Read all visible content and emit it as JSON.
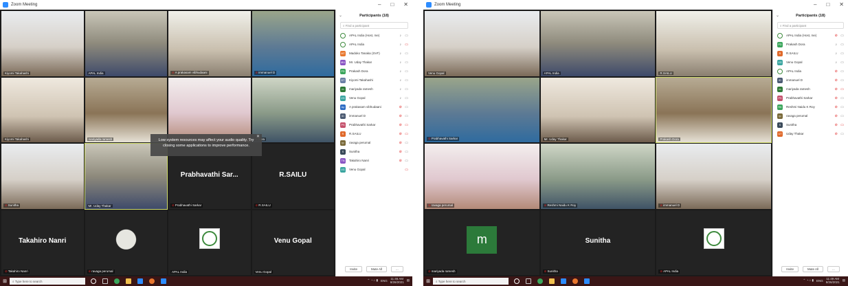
{
  "window": {
    "title": "Zoom Meeting",
    "minimize": "–",
    "maximize": "□",
    "close": "✕"
  },
  "colors": {
    "grid_bg": "#1a1a1a",
    "tile_bg": "#232323",
    "muted": "#e02828",
    "active_speaker": "#d4e06c",
    "accent": "#2d8cff"
  },
  "left": {
    "participants_title": "Participants (18)",
    "search_placeholder": "Find a participant",
    "buttons": {
      "invite": "Invite",
      "mute_all": "Mute All",
      "more": "..."
    },
    "notification": "Low system resources may affect your audio quality. Try closing some applications to improve performance.",
    "notification_close": "✕",
    "tiles": [
      {
        "name": "Kiyomi Takahashi",
        "muted": false
      },
      {
        "name": "APAL India",
        "muted": false
      },
      {
        "name": "A prakasam vibhudaani",
        "muted": true
      },
      {
        "name": "immanuel D",
        "muted": true
      },
      {
        "name": "Kiyomi Takahashi",
        "muted": false
      },
      {
        "name": "mariyada ramesh",
        "muted": false
      },
      {
        "name": "",
        "muted": false
      },
      {
        "name": "h Dora",
        "muted": false
      },
      {
        "name": "Sunitha",
        "muted": true
      },
      {
        "name": "Mr. Uday Thakar",
        "muted": false
      },
      {
        "name": "Prabhavathi Sarkar",
        "muted": true,
        "big": "Prabhavathi Sar..."
      },
      {
        "name": "R.SAILU",
        "muted": true,
        "big": "R.SAILU"
      },
      {
        "name": "Takahiro Nanri",
        "muted": true,
        "big": "Takahiro Nanri"
      },
      {
        "name": "ravaga perumal",
        "muted": true
      },
      {
        "name": "APAL India",
        "muted": false
      },
      {
        "name": "Venu Gopal",
        "muted": false,
        "big": "Venu Gopal"
      }
    ],
    "participants": [
      {
        "name": "APAL India (Host, me)",
        "color": "#ffffff",
        "initials": "",
        "mic": "on",
        "cam": "on"
      },
      {
        "name": "APAL India",
        "color": "#ffffff",
        "initials": "",
        "mic": "on",
        "cam": "off"
      },
      {
        "name": "Madoko Tanaka (SVF)",
        "color": "#e8772e",
        "initials": "MT",
        "mic": "on",
        "cam": "on"
      },
      {
        "name": "Mr. Uday Thakar",
        "color": "#8a56c4",
        "initials": "MU",
        "mic": "on",
        "cam": "on"
      },
      {
        "name": "Prakash Dora",
        "color": "#3aa55b",
        "initials": "PD",
        "mic": "on",
        "cam": "on"
      },
      {
        "name": "Kiyomi Takahashi",
        "color": "#6b7fa5",
        "initials": "KT",
        "mic": "on",
        "cam": "on"
      },
      {
        "name": "mariyada ramesh",
        "color": "#2f7a37",
        "initials": "m",
        "mic": "on",
        "cam": "on"
      },
      {
        "name": "Venu Gopal",
        "color": "#3aa5a0",
        "initials": "VG",
        "mic": "on",
        "cam": "on"
      },
      {
        "name": "A prakasam vibhudaani",
        "color": "#2d6cc4",
        "initials": "Ap",
        "mic": "muted",
        "cam": "on"
      },
      {
        "name": "immanuel D",
        "color": "#4b5a72",
        "initials": "iD",
        "mic": "muted",
        "cam": "on"
      },
      {
        "name": "Prabhavathi Sarkar",
        "color": "#c4506b",
        "initials": "PS",
        "mic": "muted",
        "cam": "off"
      },
      {
        "name": "R.SAILU",
        "color": "#e0692a",
        "initials": "R",
        "mic": "muted",
        "cam": "off"
      },
      {
        "name": "ravaga perumal",
        "color": "#7a6a3a",
        "initials": "rp",
        "mic": "muted",
        "cam": "on"
      },
      {
        "name": "Sunitha",
        "color": "#3a4a5a",
        "initials": "S",
        "mic": "muted",
        "cam": "on"
      },
      {
        "name": "Takahiro Nanri",
        "color": "#8a56c4",
        "initials": "TN",
        "mic": "muted",
        "cam": "on"
      },
      {
        "name": "Venu Gopal",
        "color": "#3aa5a0",
        "initials": "VG",
        "mic": "",
        "cam": "off"
      }
    ]
  },
  "right": {
    "participants_title": "Participants (18)",
    "search_placeholder": "Find a participant",
    "buttons": {
      "invite": "Invite",
      "mute_all": "Mute All",
      "more": "..."
    },
    "tiles": [
      {
        "name": "Venu Gopal",
        "muted": false
      },
      {
        "name": "APAL India",
        "muted": false
      },
      {
        "name": "R.SAILU",
        "muted": false
      },
      {
        "name": "Prabhavathi Sarkar",
        "muted": true
      },
      {
        "name": "Mr. Uday Thakar",
        "muted": false
      },
      {
        "name": "Prakash Dora",
        "muted": false
      },
      {
        "name": "ravaga perumal",
        "muted": true
      },
      {
        "name": "Reshmi Naidu K Roy",
        "muted": true
      },
      {
        "name": "immanuel D",
        "muted": true
      },
      {
        "name": "mariyada ramesh",
        "muted": true,
        "avatar": "m"
      },
      {
        "name": "Sunitha",
        "muted": true,
        "big": "Sunitha"
      },
      {
        "name": "APAL India",
        "muted": true
      }
    ],
    "participants": [
      {
        "name": "APAL India (Host, me)",
        "color": "#ffffff",
        "initials": "",
        "mic": "muted",
        "cam": "on"
      },
      {
        "name": "Prakash Dora",
        "color": "#3aa55b",
        "initials": "PD",
        "mic": "on",
        "cam": "on"
      },
      {
        "name": "R.SAILU",
        "color": "#e0692a",
        "initials": "R",
        "mic": "on",
        "cam": "on"
      },
      {
        "name": "Venu Gopal",
        "color": "#3aa5a0",
        "initials": "VG",
        "mic": "on",
        "cam": "on"
      },
      {
        "name": "APAL India",
        "color": "#ffffff",
        "initials": "",
        "mic": "muted",
        "cam": "on"
      },
      {
        "name": "immanuel D",
        "color": "#4b5a72",
        "initials": "iD",
        "mic": "muted",
        "cam": "on"
      },
      {
        "name": "mariyada ramesh",
        "color": "#2f7a37",
        "initials": "m",
        "mic": "muted",
        "cam": "off"
      },
      {
        "name": "Prabhavathi Sarkar",
        "color": "#c4506b",
        "initials": "PS",
        "mic": "muted",
        "cam": "on"
      },
      {
        "name": "Reshmi Naidu K Roy",
        "color": "#3aa55b",
        "initials": "RK",
        "mic": "muted",
        "cam": "on"
      },
      {
        "name": "ravaga perumal",
        "color": "#7a6a3a",
        "initials": "rp",
        "mic": "muted",
        "cam": "on"
      },
      {
        "name": "Sunitha",
        "color": "#3a4a5a",
        "initials": "S",
        "mic": "muted",
        "cam": "off"
      },
      {
        "name": "Uday Thakar",
        "color": "#e0692a",
        "initials": "UT",
        "mic": "muted",
        "cam": "on"
      }
    ]
  },
  "taskbar": {
    "search_placeholder": "Type here to search",
    "tray_lang": "ENG",
    "left_time": "11:46 AM",
    "left_date": "8/26/2021",
    "right_time": "11:49 AM",
    "right_date": "8/26/2021"
  }
}
